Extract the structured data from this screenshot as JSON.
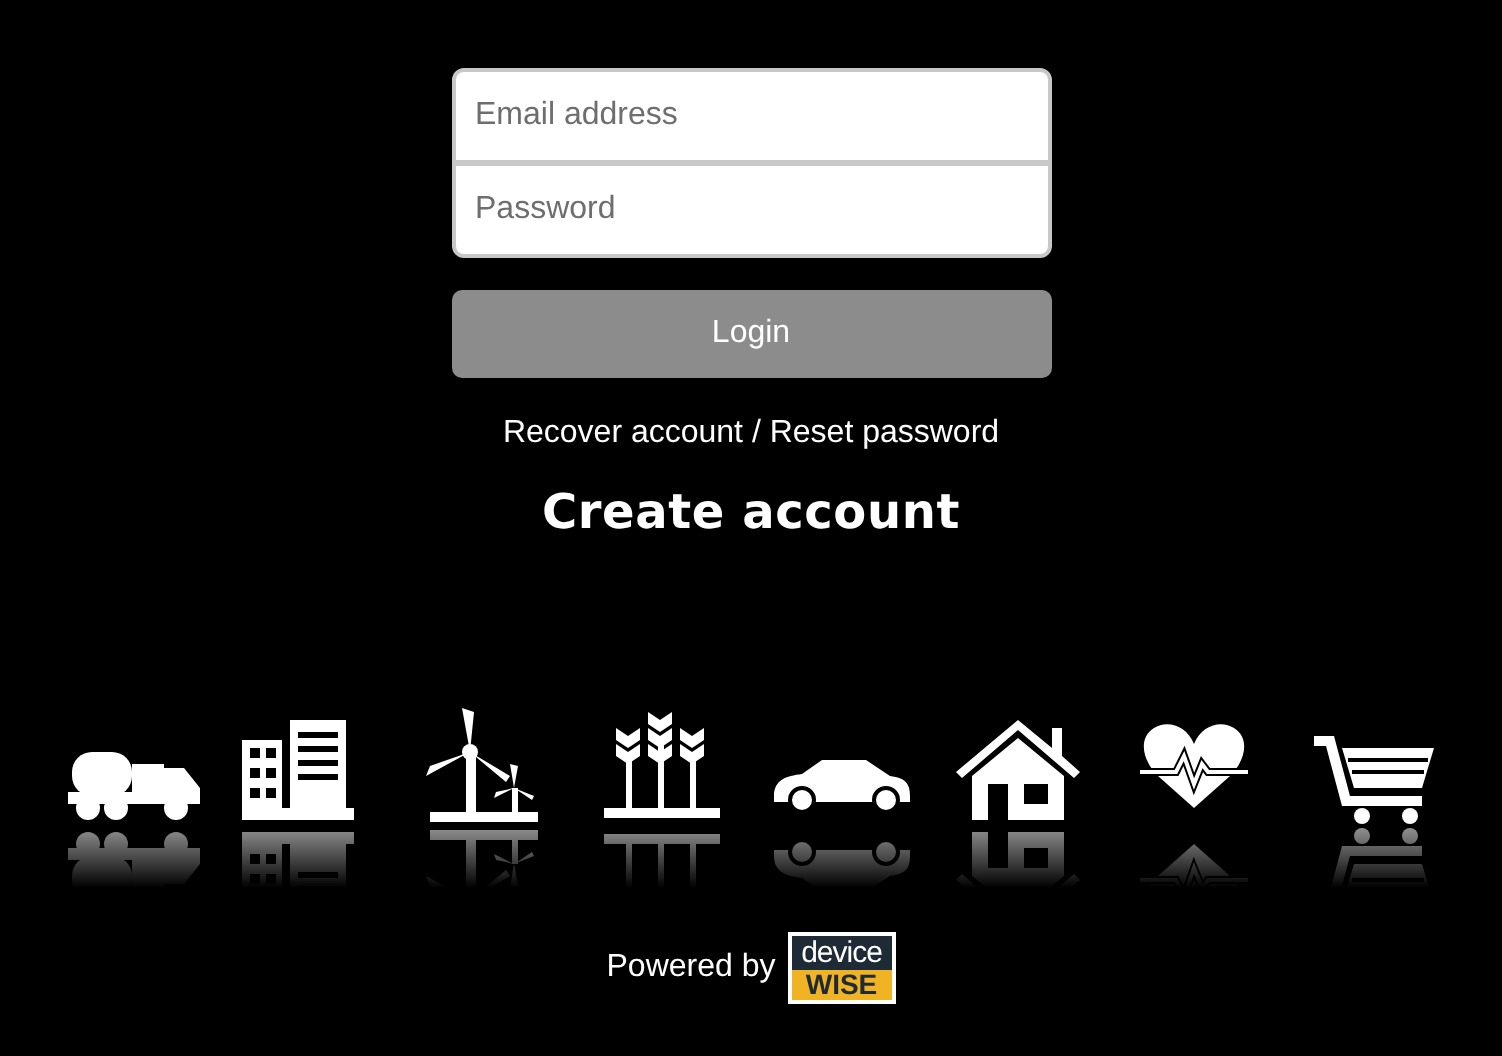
{
  "login_form": {
    "email": {
      "placeholder": "Email address"
    },
    "password": {
      "placeholder": "Password"
    },
    "login_button": "Login"
  },
  "recover_link": "Recover account / Reset password",
  "create_account_link": "Create account",
  "footer": {
    "powered_by": "Powered by",
    "logo": {
      "top": "device",
      "bottom": "WISE"
    }
  }
}
